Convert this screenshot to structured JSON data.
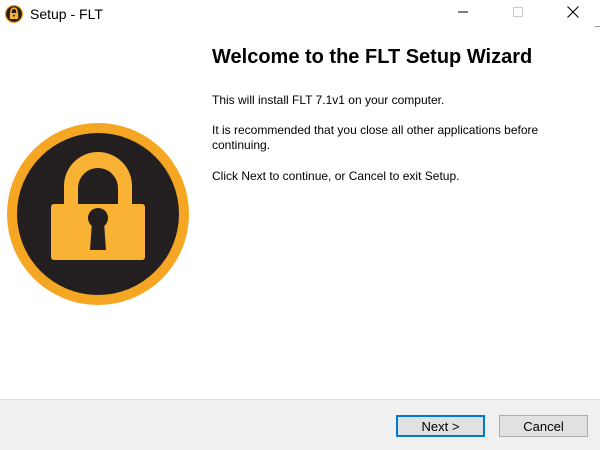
{
  "window": {
    "title": "Setup - FLT"
  },
  "content": {
    "heading": "Welcome to the FLT Setup Wizard",
    "paragraphs": [
      "This will install FLT 7.1v1 on your computer.",
      "It is recommended that you close all other applications before continuing.",
      "Click Next to continue, or Cancel to exit Setup."
    ]
  },
  "buttons": {
    "next": "Next >",
    "cancel": "Cancel"
  },
  "icons": {
    "app": "lock-icon",
    "minimize": "minimize-icon",
    "maximize": "maximize-icon",
    "close": "close-icon",
    "logo": "padlock-logo"
  },
  "colors": {
    "logo_ring": "#f5a623",
    "logo_inner": "#231f20",
    "lock_body": "#f9b233",
    "focus_border": "#0078d7"
  }
}
